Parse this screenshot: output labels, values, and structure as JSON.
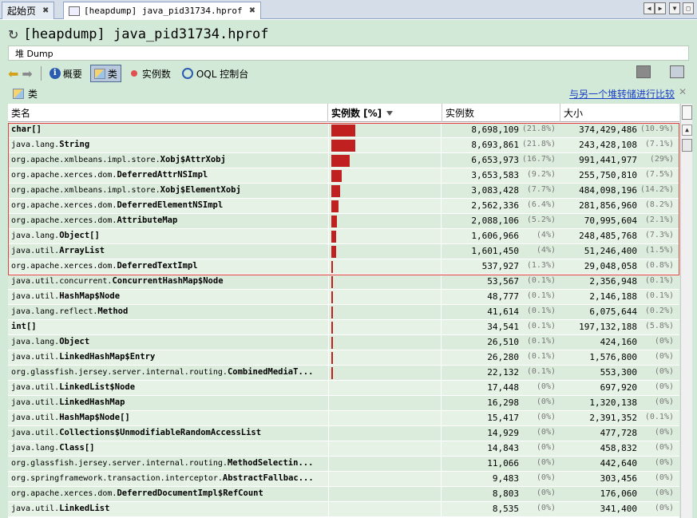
{
  "tabs": [
    {
      "label": "起始页",
      "active": false
    },
    {
      "label": "[heapdump] java_pid31734.hprof",
      "active": true
    }
  ],
  "title": "[heapdump] java_pid31734.hprof",
  "heap_label": "堆 Dump",
  "toolbar": {
    "summary": "概要",
    "classes": "类",
    "instances": "实例数",
    "oql": "OQL 控制台"
  },
  "section": {
    "label": "类",
    "compare_link": "与另一个堆转储进行比较"
  },
  "columns": {
    "name": "类名",
    "instances_pct": "实例数 [%]",
    "instances": "实例数",
    "size": "大小"
  },
  "rows": [
    {
      "pkg": "",
      "cls": "char[]",
      "pct_fill": 21.8,
      "count": "8,698,109",
      "count_pct": "(21.8%)",
      "size": "374,429,486",
      "size_pct": "(10.9%)"
    },
    {
      "pkg": "java.lang.",
      "cls": "String",
      "pct_fill": 21.8,
      "count": "8,693,861",
      "count_pct": "(21.8%)",
      "size": "243,428,108",
      "size_pct": "(7.1%)"
    },
    {
      "pkg": "org.apache.xmlbeans.impl.store.",
      "cls": "Xobj$AttrXobj",
      "pct_fill": 16.7,
      "count": "6,653,973",
      "count_pct": "(16.7%)",
      "size": "991,441,977",
      "size_pct": "(29%)"
    },
    {
      "pkg": "org.apache.xerces.dom.",
      "cls": "DeferredAttrNSImpl",
      "pct_fill": 9.2,
      "count": "3,653,583",
      "count_pct": "(9.2%)",
      "size": "255,750,810",
      "size_pct": "(7.5%)"
    },
    {
      "pkg": "org.apache.xmlbeans.impl.store.",
      "cls": "Xobj$ElementXobj",
      "pct_fill": 7.7,
      "count": "3,083,428",
      "count_pct": "(7.7%)",
      "size": "484,098,196",
      "size_pct": "(14.2%)"
    },
    {
      "pkg": "org.apache.xerces.dom.",
      "cls": "DeferredElementNSImpl",
      "pct_fill": 6.4,
      "count": "2,562,336",
      "count_pct": "(6.4%)",
      "size": "281,856,960",
      "size_pct": "(8.2%)"
    },
    {
      "pkg": "org.apache.xerces.dom.",
      "cls": "AttributeMap",
      "pct_fill": 5.2,
      "count": "2,088,106",
      "count_pct": "(5.2%)",
      "size": "70,995,604",
      "size_pct": "(2.1%)"
    },
    {
      "pkg": "java.lang.",
      "cls": "Object[]",
      "pct_fill": 4,
      "count": "1,606,966",
      "count_pct": "(4%)",
      "size": "248,485,768",
      "size_pct": "(7.3%)"
    },
    {
      "pkg": "java.util.",
      "cls": "ArrayList",
      "pct_fill": 4,
      "count": "1,601,450",
      "count_pct": "(4%)",
      "size": "51,246,400",
      "size_pct": "(1.5%)"
    },
    {
      "pkg": "org.apache.xerces.dom.",
      "cls": "DeferredTextImpl",
      "pct_fill": 1.3,
      "count": "537,927",
      "count_pct": "(1.3%)",
      "size": "29,048,058",
      "size_pct": "(0.8%)"
    },
    {
      "pkg": "java.util.concurrent.",
      "cls": "ConcurrentHashMap$Node",
      "pct_fill": 0.1,
      "count": "53,567",
      "count_pct": "(0.1%)",
      "size": "2,356,948",
      "size_pct": "(0.1%)"
    },
    {
      "pkg": "java.util.",
      "cls": "HashMap$Node",
      "pct_fill": 0.1,
      "count": "48,777",
      "count_pct": "(0.1%)",
      "size": "2,146,188",
      "size_pct": "(0.1%)"
    },
    {
      "pkg": "java.lang.reflect.",
      "cls": "Method",
      "pct_fill": 0.1,
      "count": "41,614",
      "count_pct": "(0.1%)",
      "size": "6,075,644",
      "size_pct": "(0.2%)"
    },
    {
      "pkg": "",
      "cls": "int[]",
      "pct_fill": 0.1,
      "count": "34,541",
      "count_pct": "(0.1%)",
      "size": "197,132,188",
      "size_pct": "(5.8%)"
    },
    {
      "pkg": "java.lang.",
      "cls": "Object",
      "pct_fill": 0.1,
      "count": "26,510",
      "count_pct": "(0.1%)",
      "size": "424,160",
      "size_pct": "(0%)"
    },
    {
      "pkg": "java.util.",
      "cls": "LinkedHashMap$Entry",
      "pct_fill": 0.1,
      "count": "26,280",
      "count_pct": "(0.1%)",
      "size": "1,576,800",
      "size_pct": "(0%)"
    },
    {
      "pkg": "org.glassfish.jersey.server.internal.routing.",
      "cls": "CombinedMediaT...",
      "pct_fill": 0.1,
      "count": "22,132",
      "count_pct": "(0.1%)",
      "size": "553,300",
      "size_pct": "(0%)"
    },
    {
      "pkg": "java.util.",
      "cls": "LinkedList$Node",
      "pct_fill": 0,
      "count": "17,448",
      "count_pct": "(0%)",
      "size": "697,920",
      "size_pct": "(0%)"
    },
    {
      "pkg": "java.util.",
      "cls": "LinkedHashMap",
      "pct_fill": 0,
      "count": "16,298",
      "count_pct": "(0%)",
      "size": "1,320,138",
      "size_pct": "(0%)"
    },
    {
      "pkg": "java.util.",
      "cls": "HashMap$Node[]",
      "pct_fill": 0,
      "count": "15,417",
      "count_pct": "(0%)",
      "size": "2,391,352",
      "size_pct": "(0.1%)"
    },
    {
      "pkg": "java.util.",
      "cls": "Collections$UnmodifiableRandomAccessList",
      "pct_fill": 0,
      "count": "14,929",
      "count_pct": "(0%)",
      "size": "477,728",
      "size_pct": "(0%)"
    },
    {
      "pkg": "java.lang.",
      "cls": "Class[]",
      "pct_fill": 0,
      "count": "14,843",
      "count_pct": "(0%)",
      "size": "458,832",
      "size_pct": "(0%)"
    },
    {
      "pkg": "org.glassfish.jersey.server.internal.routing.",
      "cls": "MethodSelectin...",
      "pct_fill": 0,
      "count": "11,066",
      "count_pct": "(0%)",
      "size": "442,640",
      "size_pct": "(0%)"
    },
    {
      "pkg": "org.springframework.transaction.interceptor.",
      "cls": "AbstractFallbac...",
      "pct_fill": 0,
      "count": "9,483",
      "count_pct": "(0%)",
      "size": "303,456",
      "size_pct": "(0%)"
    },
    {
      "pkg": "org.apache.xerces.dom.",
      "cls": "DeferredDocumentImpl$RefCount",
      "pct_fill": 0,
      "count": "8,803",
      "count_pct": "(0%)",
      "size": "176,060",
      "size_pct": "(0%)"
    },
    {
      "pkg": "java.util.",
      "cls": "LinkedList",
      "pct_fill": 0,
      "count": "8,535",
      "count_pct": "(0%)",
      "size": "341,400",
      "size_pct": "(0%)"
    }
  ]
}
